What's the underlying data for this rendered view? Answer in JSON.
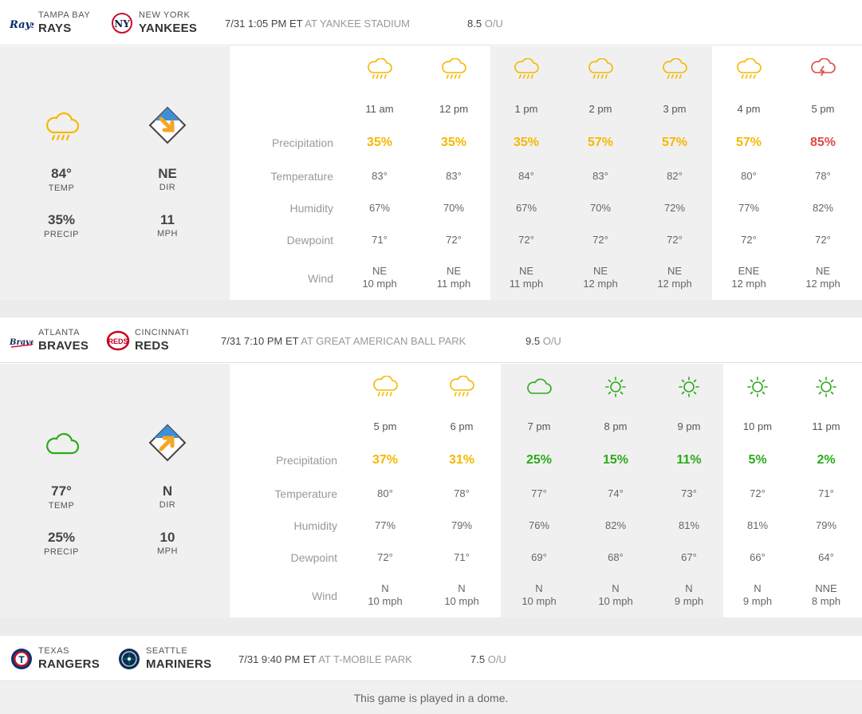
{
  "colors": {
    "yellow": "#f5b800",
    "red": "#e04848",
    "green": "#2caa1a",
    "orange": "#f5a623"
  },
  "games": [
    {
      "away": {
        "city": "TAMPA BAY",
        "name": "RAYS",
        "logo": "rays-logo"
      },
      "home": {
        "city": "NEW YORK",
        "name": "YANKEES",
        "logo": "yankees-logo"
      },
      "time": "7/31 1:05 PM ET",
      "venue": "AT YANKEE STADIUM",
      "ou_value": "8.5",
      "ou_label": "O/U",
      "summary": {
        "icon": "rain-cloud-icon",
        "temp": "84°",
        "temp_label": "TEMP",
        "precip": "35%",
        "precip_label": "PRECIP",
        "dir": "NE",
        "dir_label": "DIR",
        "mph": "11",
        "mph_label": "MPH",
        "wind_arrow": "arrow-down-right-icon"
      },
      "row_labels": {
        "precip": "Precipitation",
        "temp": "Temperature",
        "humidity": "Humidity",
        "dewpoint": "Dewpoint",
        "wind": "Wind"
      },
      "hours": [
        {
          "time": "11 am",
          "icon": "rain-cloud-icon",
          "precip": "35%",
          "level": "yellow",
          "temp": "83°",
          "humidity": "67%",
          "dewpoint": "71°",
          "wind_dir": "NE",
          "wind_speed": "10 mph"
        },
        {
          "time": "12 pm",
          "icon": "rain-cloud-icon",
          "precip": "35%",
          "level": "yellow",
          "temp": "83°",
          "humidity": "70%",
          "dewpoint": "72°",
          "wind_dir": "NE",
          "wind_speed": "11 mph"
        },
        {
          "time": "1 pm",
          "icon": "rain-cloud-icon",
          "precip": "35%",
          "level": "yellow",
          "temp": "84°",
          "humidity": "67%",
          "dewpoint": "72°",
          "wind_dir": "NE",
          "wind_speed": "11 mph"
        },
        {
          "time": "2 pm",
          "icon": "rain-cloud-icon",
          "precip": "57%",
          "level": "yellow",
          "temp": "83°",
          "humidity": "70%",
          "dewpoint": "72°",
          "wind_dir": "NE",
          "wind_speed": "12 mph"
        },
        {
          "time": "3 pm",
          "icon": "rain-cloud-icon",
          "precip": "57%",
          "level": "yellow",
          "temp": "82°",
          "humidity": "72%",
          "dewpoint": "72°",
          "wind_dir": "NE",
          "wind_speed": "12 mph"
        },
        {
          "time": "4 pm",
          "icon": "rain-cloud-icon",
          "precip": "57%",
          "level": "yellow",
          "temp": "80°",
          "humidity": "77%",
          "dewpoint": "72°",
          "wind_dir": "ENE",
          "wind_speed": "12 mph"
        },
        {
          "time": "5 pm",
          "icon": "thunderstorm-icon",
          "precip": "85%",
          "level": "red",
          "temp": "78°",
          "humidity": "82%",
          "dewpoint": "72°",
          "wind_dir": "NE",
          "wind_speed": "12 mph"
        }
      ]
    },
    {
      "away": {
        "city": "ATLANTA",
        "name": "BRAVES",
        "logo": "braves-logo"
      },
      "home": {
        "city": "CINCINNATI",
        "name": "REDS",
        "logo": "reds-logo"
      },
      "time": "7/31 7:10 PM ET",
      "venue": "AT GREAT AMERICAN BALL PARK",
      "ou_value": "9.5",
      "ou_label": "O/U",
      "summary": {
        "icon": "cloud-icon",
        "temp": "77°",
        "temp_label": "TEMP",
        "precip": "25%",
        "precip_label": "PRECIP",
        "dir": "N",
        "dir_label": "DIR",
        "mph": "10",
        "mph_label": "MPH",
        "wind_arrow": "arrow-up-right-icon"
      },
      "row_labels": {
        "precip": "Precipitation",
        "temp": "Temperature",
        "humidity": "Humidity",
        "dewpoint": "Dewpoint",
        "wind": "Wind"
      },
      "hours": [
        {
          "time": "5 pm",
          "icon": "rain-cloud-icon",
          "precip": "37%",
          "level": "yellow",
          "temp": "80°",
          "humidity": "77%",
          "dewpoint": "72°",
          "wind_dir": "N",
          "wind_speed": "10 mph"
        },
        {
          "time": "6 pm",
          "icon": "rain-cloud-icon",
          "precip": "31%",
          "level": "yellow",
          "temp": "78°",
          "humidity": "79%",
          "dewpoint": "71°",
          "wind_dir": "N",
          "wind_speed": "10 mph"
        },
        {
          "time": "7 pm",
          "icon": "cloud-icon",
          "precip": "25%",
          "level": "green",
          "temp": "77°",
          "humidity": "76%",
          "dewpoint": "69°",
          "wind_dir": "N",
          "wind_speed": "10 mph"
        },
        {
          "time": "8 pm",
          "icon": "sun-icon",
          "precip": "15%",
          "level": "green",
          "temp": "74°",
          "humidity": "82%",
          "dewpoint": "68°",
          "wind_dir": "N",
          "wind_speed": "10 mph"
        },
        {
          "time": "9 pm",
          "icon": "sun-icon",
          "precip": "11%",
          "level": "green",
          "temp": "73°",
          "humidity": "81%",
          "dewpoint": "67°",
          "wind_dir": "N",
          "wind_speed": "9 mph"
        },
        {
          "time": "10 pm",
          "icon": "sun-icon",
          "precip": "5%",
          "level": "green",
          "temp": "72°",
          "humidity": "81%",
          "dewpoint": "66°",
          "wind_dir": "N",
          "wind_speed": "9 mph"
        },
        {
          "time": "11 pm",
          "icon": "sun-icon",
          "precip": "2%",
          "level": "green",
          "temp": "71°",
          "humidity": "79%",
          "dewpoint": "64°",
          "wind_dir": "NNE",
          "wind_speed": "8 mph"
        }
      ]
    },
    {
      "away": {
        "city": "TEXAS",
        "name": "RANGERS",
        "logo": "rangers-logo"
      },
      "home": {
        "city": "SEATTLE",
        "name": "MARINERS",
        "logo": "mariners-logo"
      },
      "time": "7/31 9:40 PM ET",
      "venue": "AT T-MOBILE PARK",
      "ou_value": "7.5",
      "ou_label": "O/U",
      "note": "This game is played in a dome."
    }
  ]
}
